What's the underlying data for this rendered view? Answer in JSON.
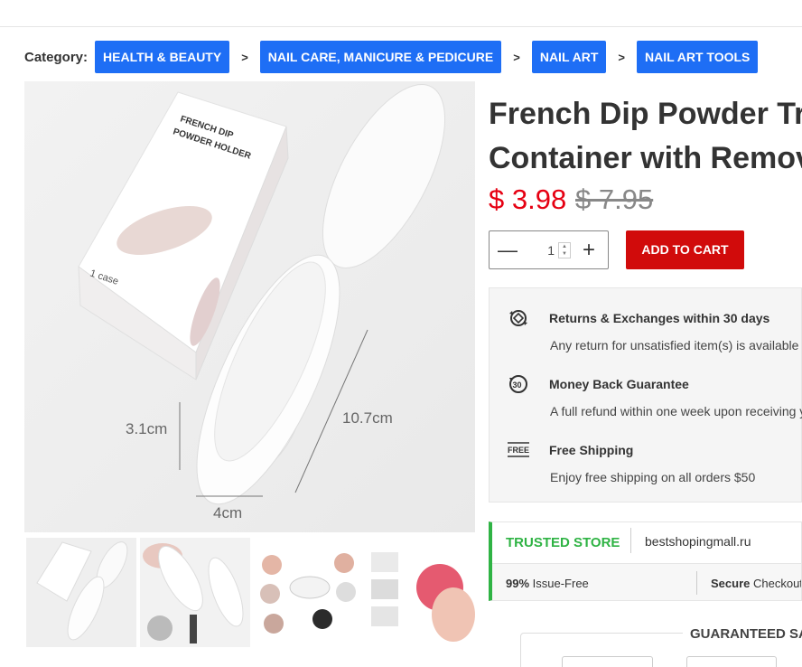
{
  "breadcrumb": {
    "label": "Category:",
    "separator": ">",
    "items": [
      "HEALTH & BEAUTY",
      "NAIL CARE, MANICURE & PEDICURE",
      "NAIL ART",
      "NAIL ART TOOLS"
    ]
  },
  "product": {
    "title_line1": "French Dip Powder Tra",
    "title_line2": "Container with Remov",
    "price": "$ 3.98",
    "old_price": "$ 7.95",
    "main_image": {
      "box_line1": "FRENCH DIP",
      "box_line2": "POWDER HOLDER",
      "box_side": "1 case",
      "dim_height": "3.1cm",
      "dim_length": "10.7cm",
      "dim_width": "4cm"
    }
  },
  "quantity": {
    "value": "1",
    "minus_icon": "minus-icon",
    "plus_icon": "plus-icon"
  },
  "cart": {
    "add_label": "ADD TO CART"
  },
  "features": [
    {
      "icon": "exchange-icon",
      "title": "Returns & Exchanges within 30 days",
      "desc": "Any return for unsatisfied item(s) is available w"
    },
    {
      "icon": "30-days-icon",
      "title": "Money Back Guarantee",
      "desc": "A full refund within one week upon receiving y"
    },
    {
      "icon": "free-shipping-icon",
      "title": "Free Shipping",
      "desc": "Enjoy free shipping on all orders $50"
    }
  ],
  "trusted": {
    "label": "TRUSTED STORE",
    "domain": "bestshopingmall.ru",
    "issue_bold": "99%",
    "issue_rest": " Issue-Free",
    "secure_bold": "Secure",
    "secure_rest": " Checkout"
  },
  "guarantee": {
    "title": "GUARANTEED SA"
  },
  "colors": {
    "accent": "#1e6ef5",
    "price": "#e60012",
    "cart": "#d10b0b",
    "trusted": "#2fb344"
  }
}
